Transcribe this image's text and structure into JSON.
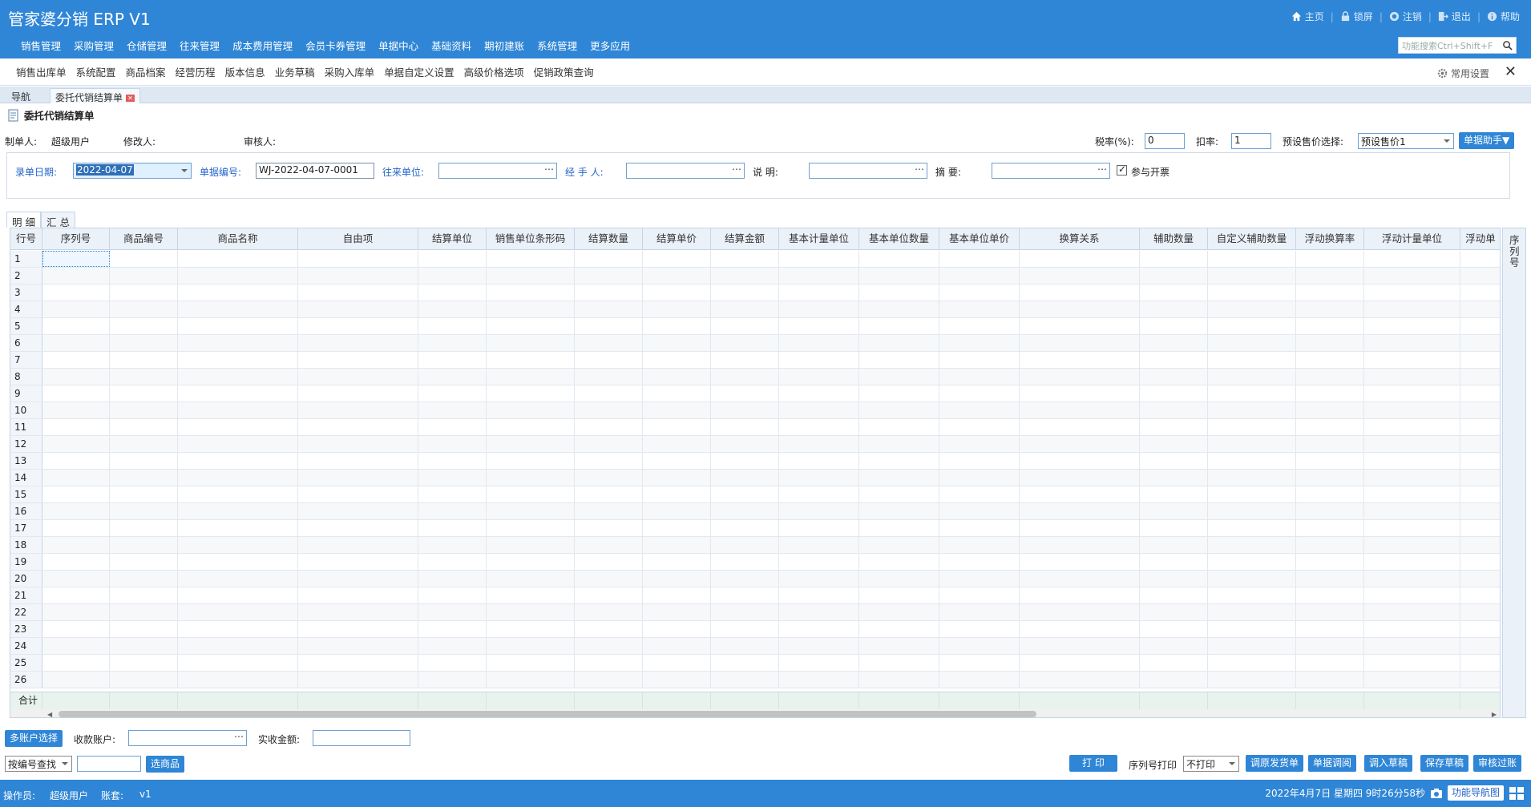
{
  "app": {
    "title": "管家婆分销 ERP V1"
  },
  "top_actions": {
    "home": "主页",
    "lock": "锁屏",
    "logout_user": "注销",
    "exit": "退出",
    "help": "帮助"
  },
  "main_nav": [
    "销售管理",
    "采购管理",
    "仓储管理",
    "往来管理",
    "成本费用管理",
    "会员卡券管理",
    "单据中心",
    "基础资料",
    "期初建账",
    "系统管理",
    "更多应用"
  ],
  "search": {
    "placeholder": "功能搜索Ctrl+Shift+F"
  },
  "quick_links": [
    "销售出库单",
    "系统配置",
    "商品档案",
    "经营历程",
    "版本信息",
    "业务草稿",
    "采购入库单",
    "单据自定义设置",
    "高级价格选项",
    "促销政策查询"
  ],
  "common_settings": "常用设置",
  "tabs": {
    "nav": "导航",
    "active": "委托代销结算单"
  },
  "doc": {
    "title": "委托代销结算单"
  },
  "meta": {
    "creator_label": "制单人:",
    "creator_value": "超级用户",
    "modifier_label": "修改人:",
    "auditor_label": "审核人:",
    "tax_label": "税率(%):",
    "tax_value": "0",
    "discount_label": "扣率:",
    "discount_value": "1",
    "preset_label": "预设售价选择:",
    "preset_value": "预设售价1",
    "helper_button": "单据助手▼"
  },
  "form": {
    "date_label": "录单日期:",
    "date_value": "2022-04-07",
    "number_label": "单据编号:",
    "number_value": "WJ-2022-04-07-0001",
    "partner_label": "往来单位:",
    "handler_label": "经 手 人:",
    "remark_label": "说 明:",
    "summary_label": "摘 要:",
    "invoice_label": "参与开票"
  },
  "sub_tabs": [
    "明 细",
    "汇 总"
  ],
  "grid": {
    "columns": [
      "行号",
      "序列号",
      "商品编号",
      "商品名称",
      "自由项",
      "结算单位",
      "销售单位条形码",
      "结算数量",
      "结算单价",
      "结算金额",
      "基本计量单位",
      "基本单位数量",
      "基本单位单价",
      "换算关系",
      "辅助数量",
      "自定义辅助数量",
      "浮动换算率",
      "浮动计量单位",
      "浮动单"
    ],
    "rows": [
      "1",
      "2",
      "3",
      "4",
      "5",
      "6",
      "7",
      "8",
      "9",
      "10",
      "11",
      "12",
      "13",
      "14",
      "15",
      "16",
      "17",
      "18",
      "19",
      "20",
      "21",
      "22",
      "23",
      "24",
      "25",
      "26"
    ],
    "total_label": "合计",
    "side_label": "序列号"
  },
  "bottom": {
    "multi_account_button": "多账户选择",
    "receive_account_label": "收款账户:",
    "actual_amount_label": "实收金额:",
    "lookup_select": "按编号查找",
    "select_goods_button": "选商品",
    "print_button": "打 印",
    "serial_print_label": "序列号打印",
    "serial_print_value": "不打印",
    "buttons": [
      "调原发货单",
      "单据调阅",
      "调入草稿",
      "保存草稿",
      "审核过账"
    ]
  },
  "status": {
    "operator_label": "操作员:",
    "operator_value": "超级用户",
    "account_label": "账套:",
    "account_value": "v1",
    "datetime": "2022年4月7日 星期四 9时26分58秒",
    "nav_map_button": "功能导航图"
  },
  "colors": {
    "brand": "#2f86d6",
    "label_blue": "#2464c9"
  }
}
